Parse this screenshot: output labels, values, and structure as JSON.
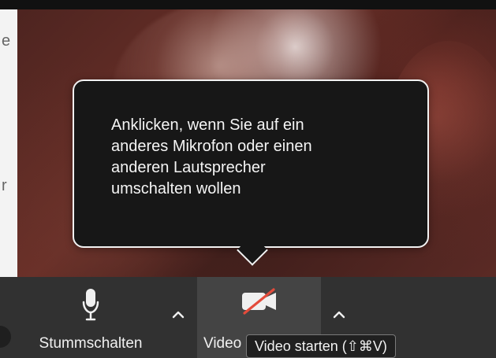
{
  "left_edge": {
    "glyph_top": "e",
    "glyph_bottom": "r"
  },
  "tooltip": {
    "text": "Anklicken, wenn Sie auf ein\nanderes Mikrofon oder einen\nanderen Lautsprecher\numschalten wollen"
  },
  "toolbar": {
    "mute_label": "Stummschalten",
    "video_label": "Video"
  },
  "hint": {
    "text": "Video starten (⇧⌘V)"
  },
  "icons": {
    "microphone": "microphone-icon",
    "video_off": "video-camera-off-icon",
    "chevron_up": "chevron-up-icon"
  },
  "colors": {
    "toolbar_bg": "#313131",
    "active_button_bg": "#444444",
    "tooltip_bg": "#171717",
    "tooltip_border": "#f2f2f2",
    "muted_slash": "#e34b3b"
  }
}
